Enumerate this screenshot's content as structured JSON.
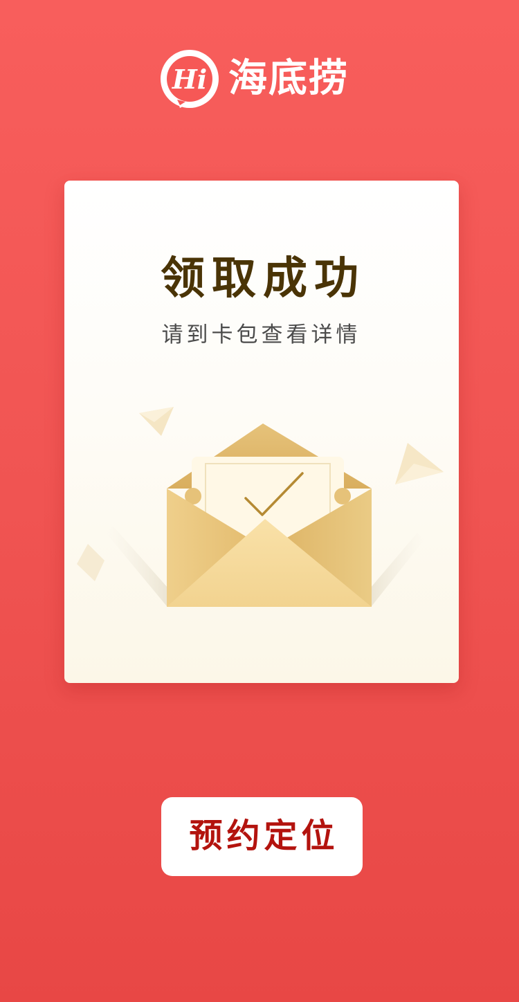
{
  "brand": {
    "name": "海底捞",
    "logo_icon": "hi-speech-bubble-icon",
    "logo_mark_text": "Hi",
    "color": "#FFFFFF"
  },
  "card": {
    "title": "领取成功",
    "subtitle": "请到卡包查看详情",
    "illustration_icon": "open-envelope-check-icon"
  },
  "actions": {
    "primary_label": "预约定位"
  },
  "colors": {
    "background_top": "#F85E5C",
    "background_bottom": "#E84745",
    "button_text": "#B3130E",
    "title_text": "#4A3406",
    "envelope": "#E8C277"
  }
}
